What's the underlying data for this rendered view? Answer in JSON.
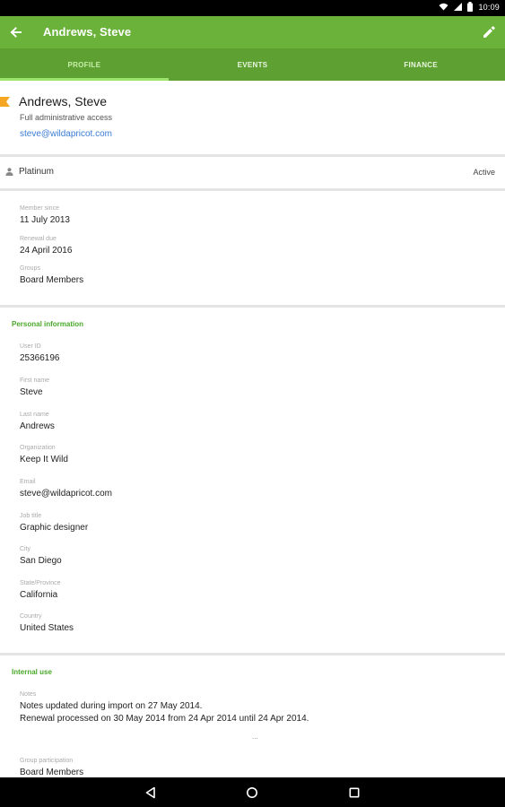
{
  "status_bar": {
    "time": "10:09",
    "icons": [
      "wifi-icon",
      "signal-icon",
      "battery-icon"
    ]
  },
  "app_bar": {
    "title": "Andrews, Steve",
    "back_icon": "arrow-back-icon",
    "edit_icon": "pencil-icon",
    "color": "#6ab23a"
  },
  "tabs": [
    {
      "label": "PROFILE",
      "active": true
    },
    {
      "label": "EVENTS",
      "active": false
    },
    {
      "label": "FINANCE",
      "active": false
    }
  ],
  "header": {
    "name": "Andrews, Steve",
    "access": "Full administrative access",
    "email": "steve@wildapricot.com",
    "flag_color": "#f5a623"
  },
  "membership": {
    "level": "Platinum",
    "status": "Active"
  },
  "membership_fields": [
    {
      "label": "Member since",
      "value": "11 July 2013"
    },
    {
      "label": "Renewal due",
      "value": "24 April 2016"
    },
    {
      "label": "Groups",
      "value": "Board Members"
    }
  ],
  "personal": {
    "title": "Personal information",
    "fields": [
      {
        "label": "User ID",
        "value": "25366196"
      },
      {
        "label": "First name",
        "value": "Steve"
      },
      {
        "label": "Last name",
        "value": "Andrews"
      },
      {
        "label": "Organization",
        "value": "Keep It Wild"
      },
      {
        "label": "Email",
        "value": "steve@wildapricot.com"
      },
      {
        "label": "Job title",
        "value": "Graphic designer"
      },
      {
        "label": "City",
        "value": "San Diego"
      },
      {
        "label": "State/Province",
        "value": "California"
      },
      {
        "label": "Country",
        "value": "United States"
      }
    ]
  },
  "internal": {
    "title": "Internal use",
    "notes_label": "Notes",
    "notes_line1": "Notes updated during import on 27 May 2014.",
    "notes_line2": "Renewal processed on 30 May 2014 from 24 Apr 2014 until 24 Apr 2014.",
    "more": "...",
    "group_label": "Group participation",
    "group_value": "Board Members"
  },
  "nav_bar": {
    "icons": [
      "back-triangle-icon",
      "home-circle-icon",
      "recents-square-icon"
    ]
  }
}
